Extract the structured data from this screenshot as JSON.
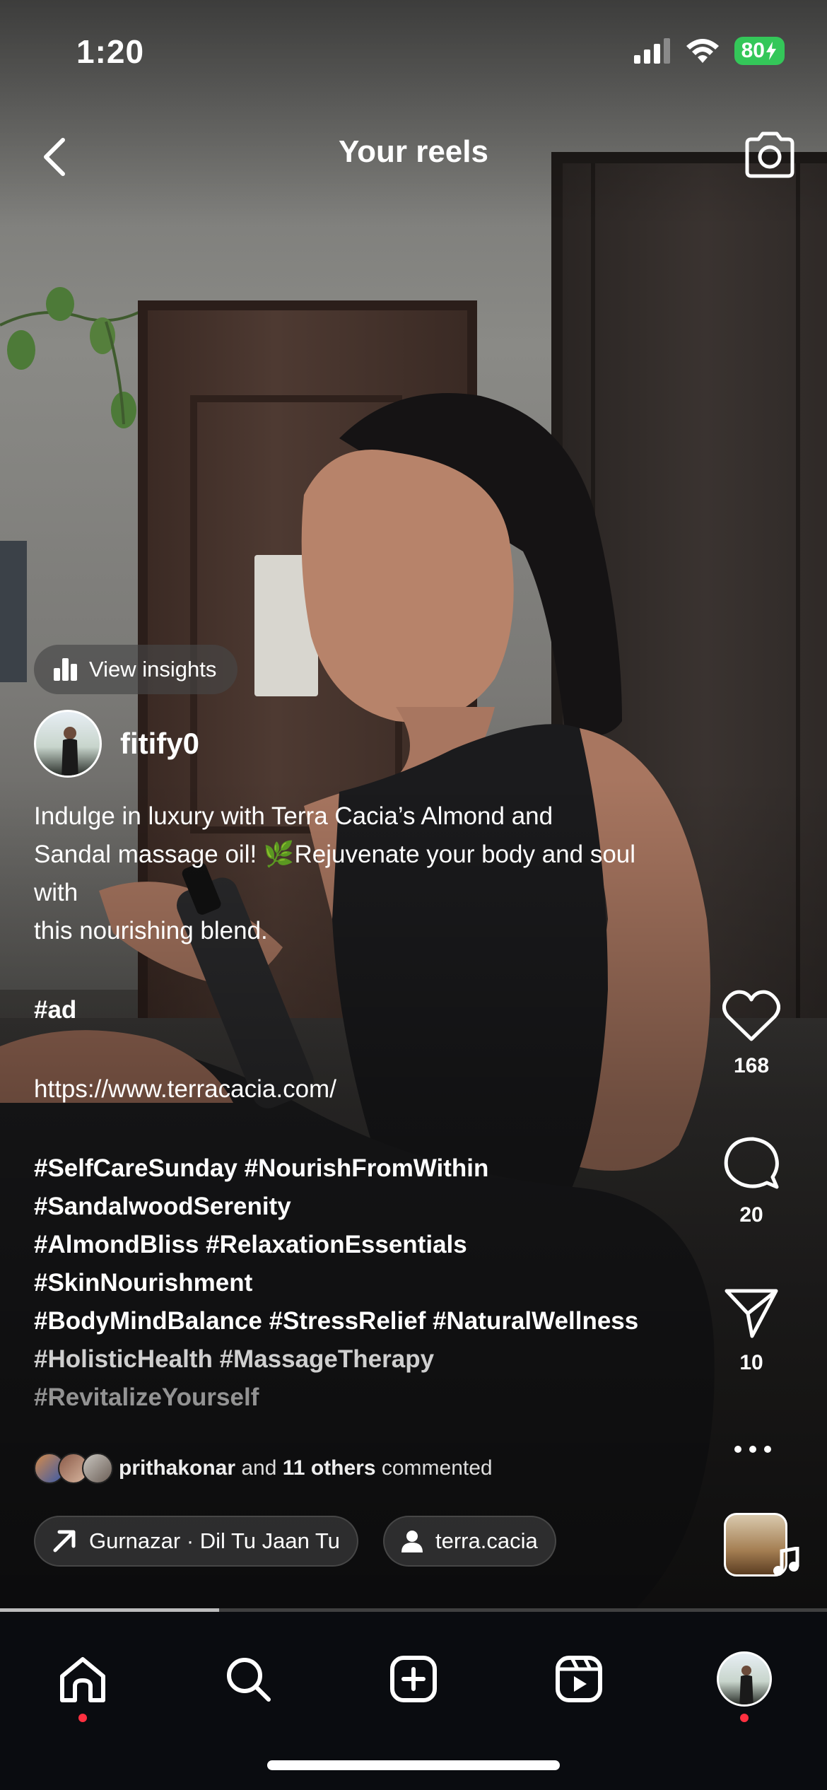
{
  "status_bar": {
    "time": "1:20",
    "battery": "80"
  },
  "header": {
    "title": "Your reels"
  },
  "insights": {
    "label": "View insights"
  },
  "author": {
    "username": "fitify0"
  },
  "caption": {
    "lines": [
      "Indulge in luxury with Terra Cacia’s Almond and",
      "Sandal massage oil! 🌿Rejuvenate your body and soul",
      "with",
      "this nourishing blend."
    ],
    "ad_tag": "#ad",
    "link": "https://www.terracacia.com/",
    "hashtag_lines": [
      "#SelfCareSunday #NourishFromWithin",
      "#SandalwoodSerenity",
      "#AlmondBliss #RelaxationEssentials",
      "#SkinNourishment",
      "#BodyMindBalance #StressRelief #NaturalWellness",
      "#HolisticHealth #MassageTherapy",
      "#RevitalizeYourself"
    ]
  },
  "comments_summary": {
    "user": "prithakonar",
    "and": "and",
    "others": "11 others",
    "suffix": "commented"
  },
  "audio": {
    "label": "Gurnazar · Dil Tu Jaan Tu"
  },
  "tagged": {
    "label": "terra.cacia"
  },
  "actions": {
    "likes": "168",
    "comments": "20",
    "shares": "10"
  },
  "progress": {
    "fraction": 0.265
  },
  "nav": {
    "items": [
      "home-icon",
      "search-icon",
      "create-icon",
      "reels-icon",
      "profile-avatar"
    ]
  },
  "colors": {
    "accent_red": "#ff3040",
    "battery_green": "#34c759",
    "nav_bg": "#0a0c10"
  }
}
